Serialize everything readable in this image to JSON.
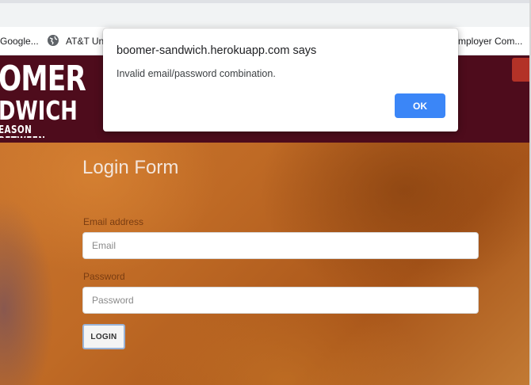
{
  "bookmarks": [
    {
      "label": "Google..."
    },
    {
      "label": "AT&T Un"
    },
    {
      "label": "mployer Com..."
    }
  ],
  "site": {
    "logo_line1": "OMER",
    "logo_line2": "DWICH",
    "logo_line3": "EASON BETWEEN"
  },
  "login_form": {
    "title": "Login Form",
    "email_label": "Email address",
    "email_placeholder": "Email",
    "password_label": "Password",
    "password_placeholder": "Password",
    "login_button": "LOGIN"
  },
  "alert": {
    "title": "boomer-sandwich.herokuapp.com says",
    "message": "Invalid email/password combination.",
    "ok_button": "OK"
  },
  "colors": {
    "header": "#4e0c1c",
    "accent": "#3b86f7",
    "hero": "#bf6a25"
  }
}
